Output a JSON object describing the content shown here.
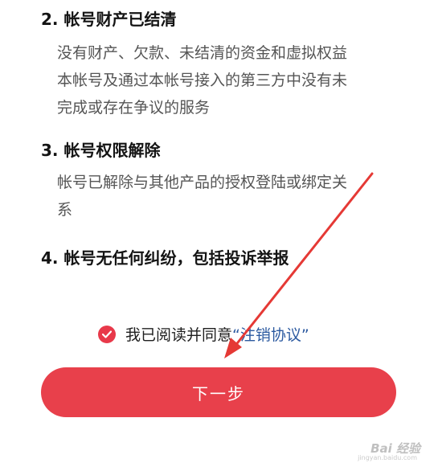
{
  "sections": [
    {
      "heading": "2. 帐号财产已结清",
      "lines": [
        "没有财产、欠款、未结清的资金和虚拟权益",
        "本帐号及通过本帐号接入的第三方中没有未",
        "完成或存在争议的服务"
      ]
    },
    {
      "heading": "3. 帐号权限解除",
      "lines": [
        "帐号已解除与其他产品的授权登陆或绑定关",
        "系"
      ]
    },
    {
      "heading": "4. 帐号无任何纠纷，包括投诉举报",
      "lines": []
    }
  ],
  "agreement": {
    "checked": true,
    "text": "我已阅读并同意",
    "link": "“注销协议”"
  },
  "next_button": "下一步",
  "colors": {
    "accent": "#e8404b",
    "link": "#2c5aa0",
    "annotation_arrow": "#e53935"
  },
  "watermark": {
    "text": "Bai 经验",
    "sub": "jingyan.baidu.com"
  }
}
